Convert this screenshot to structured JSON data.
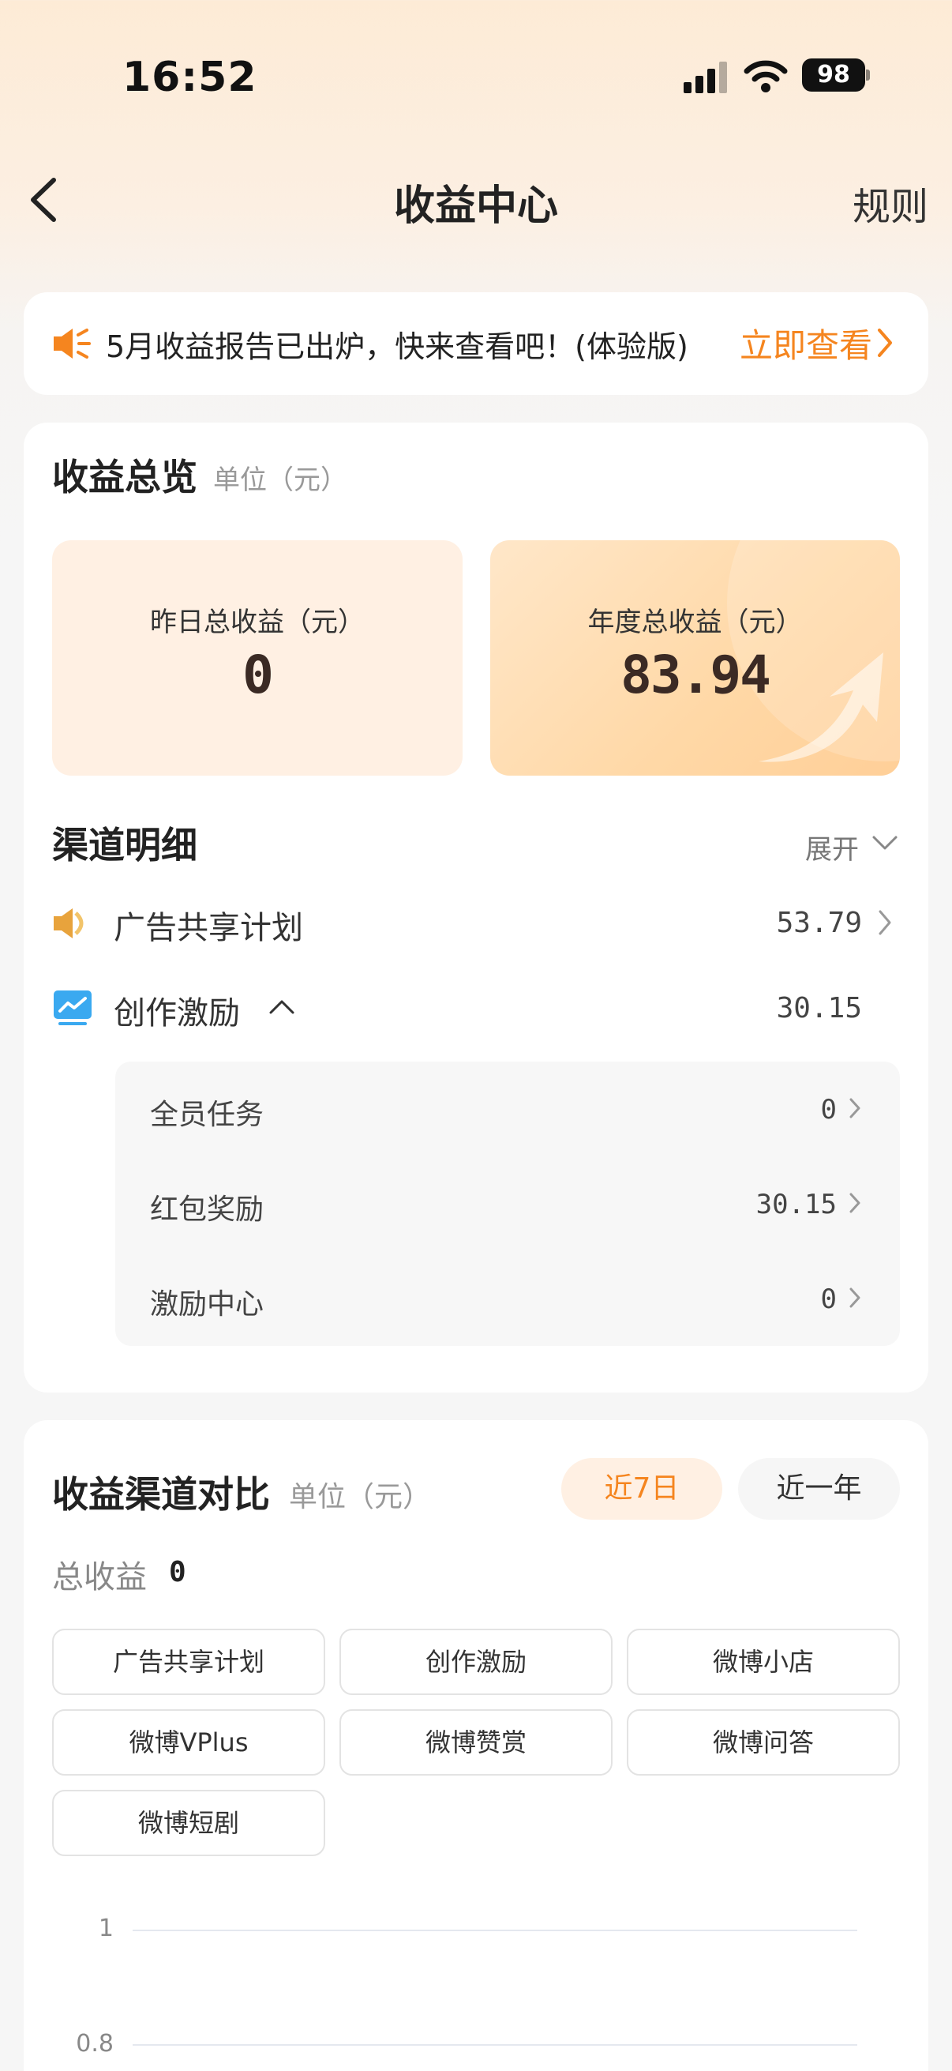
{
  "status": {
    "time": "16:52",
    "battery": "98"
  },
  "nav": {
    "title": "收益中心",
    "rules_label": "规则"
  },
  "banner": {
    "text": "5月收益报告已出炉，快来查看吧！(体验版)",
    "link": "立即查看"
  },
  "overview": {
    "title": "收益总览",
    "unit": "单位（元）",
    "yesterday": {
      "label": "昨日总收益（元）",
      "value": "0"
    },
    "year": {
      "label": "年度总收益（元）",
      "value": "83.94"
    }
  },
  "channels": {
    "title": "渠道明细",
    "expand_label": "展开",
    "items": [
      {
        "label": "广告共享计划",
        "value": "53.79",
        "icon": "megaphone-icon"
      },
      {
        "label": "创作激励",
        "value": "30.15",
        "icon": "chart-icon"
      }
    ],
    "sub_items": [
      {
        "label": "全员任务",
        "value": "0"
      },
      {
        "label": "红包奖励",
        "value": "30.15"
      },
      {
        "label": "激励中心",
        "value": "0"
      }
    ]
  },
  "comparison": {
    "title": "收益渠道对比",
    "unit": "单位（元）",
    "tabs": [
      {
        "label": "近7日",
        "active": true
      },
      {
        "label": "近一年",
        "active": false
      }
    ],
    "total_label": "总收益",
    "total_value": "0",
    "chips": [
      "广告共享计划",
      "创作激励",
      "微博小店",
      "微博VPlus",
      "微博赞赏",
      "微博问答",
      "微博短剧"
    ],
    "y_ticks": [
      "1",
      "0.8"
    ]
  },
  "colors": {
    "accent": "#f5851f",
    "card_warm": "#fff0e3"
  }
}
